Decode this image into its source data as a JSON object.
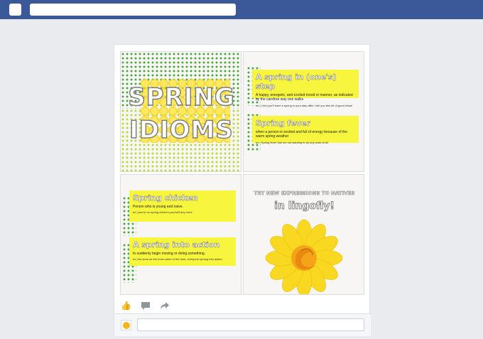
{
  "topbar": {
    "color": "#3b5998",
    "search": {
      "value": "",
      "placeholder": ""
    }
  },
  "post": {
    "tiles": {
      "cover": {
        "title_line1": "SPRING",
        "title_line2": "IDIOMS"
      },
      "idioms": [
        {
          "title": "A spring in (one's) step",
          "definition": "A happy, energetic, and excited mood or manner, as indicated by the carefree way one walks",
          "example": "ex.) I bet you'll have a spring in your step after I tell you this bit of good news!"
        },
        {
          "title": "Spring fever",
          "definition": "when a person is excited and full of energy because of the warm spring weather",
          "example": "ex.) Spring fever has me not wanting to do any work at all."
        },
        {
          "title": "Spring chicken",
          "definition": "Person who is young and naive.",
          "example": "ex.) you're no spring chicken yourself any more"
        },
        {
          "title": "A spring into action",
          "definition": "to suddenly begin moving or doing something.",
          "example": "ex.) As soon as the boss came in the door, everyone sprang into action."
        }
      ],
      "promo": {
        "line1": "TRY NEW EXPRESSIONS TO NATIVES",
        "line2": "in lingofly!"
      }
    },
    "actions": {
      "like_icon": "thumbs-up-icon",
      "comment_icon": "comment-bubble-icon",
      "share_icon": "share-arrow-icon"
    },
    "comment": {
      "value": "",
      "placeholder": ""
    }
  },
  "colors": {
    "card_yellow": "#f7f53e",
    "dot_green": "#4aa83a",
    "dot_yellow": "#b8d935",
    "petal": "#f8d820"
  }
}
